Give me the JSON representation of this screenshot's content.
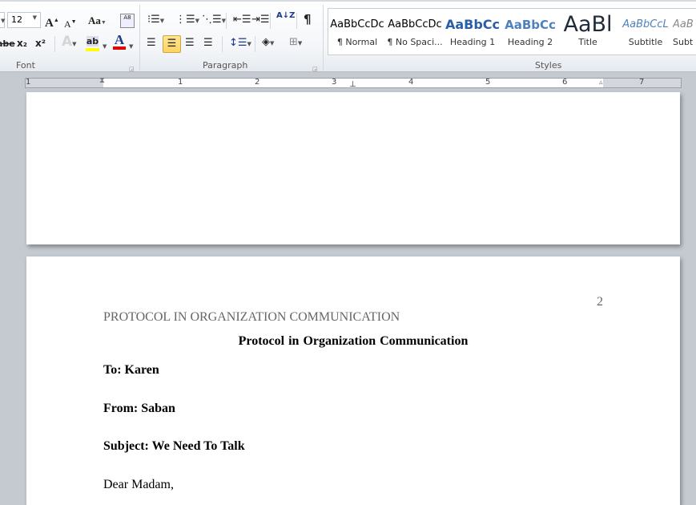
{
  "ribbon": {
    "font_group": {
      "label": "Font",
      "font_size": "12",
      "grow_icon": "A",
      "shrink_icon": "A",
      "change_case": "Aa",
      "strike": "abe",
      "subscript": "x₂",
      "superscript": "x²",
      "text_effects": "A",
      "highlight": "ab",
      "font_color": "A",
      "highlight_color": "#ffff00",
      "font_color_value": "#e00000"
    },
    "paragraph_group": {
      "label": "Paragraph",
      "show_marks": "¶",
      "sort": "A↓Z"
    },
    "styles_group": {
      "label": "Styles",
      "items": [
        {
          "preview": "AaBbCcDc",
          "name": "¶ Normal"
        },
        {
          "preview": "AaBbCcDc",
          "name": "¶ No Spaci..."
        },
        {
          "preview": "AaBbCc",
          "name": "Heading 1"
        },
        {
          "preview": "AaBbCc",
          "name": "Heading 2"
        },
        {
          "preview": "AaBl",
          "name": "Title"
        },
        {
          "preview": "AaBbCcL",
          "name": "Subtitle"
        },
        {
          "preview": "AaB",
          "name": "Subt"
        }
      ]
    },
    "active_alignment": "center"
  },
  "ruler": {
    "numbers": [
      "1",
      "1",
      "2",
      "3",
      "4",
      "5",
      "6",
      "7"
    ]
  },
  "document": {
    "page_number": "2",
    "running_head": "PROTOCOL IN ORGANIZATION COMMUNICATION",
    "title": "Protocol in Organization  Communication",
    "to": "To: Karen",
    "from": "From: Saban",
    "subject": "Subject: We Need To Talk",
    "salutation": "Dear Madam,"
  }
}
